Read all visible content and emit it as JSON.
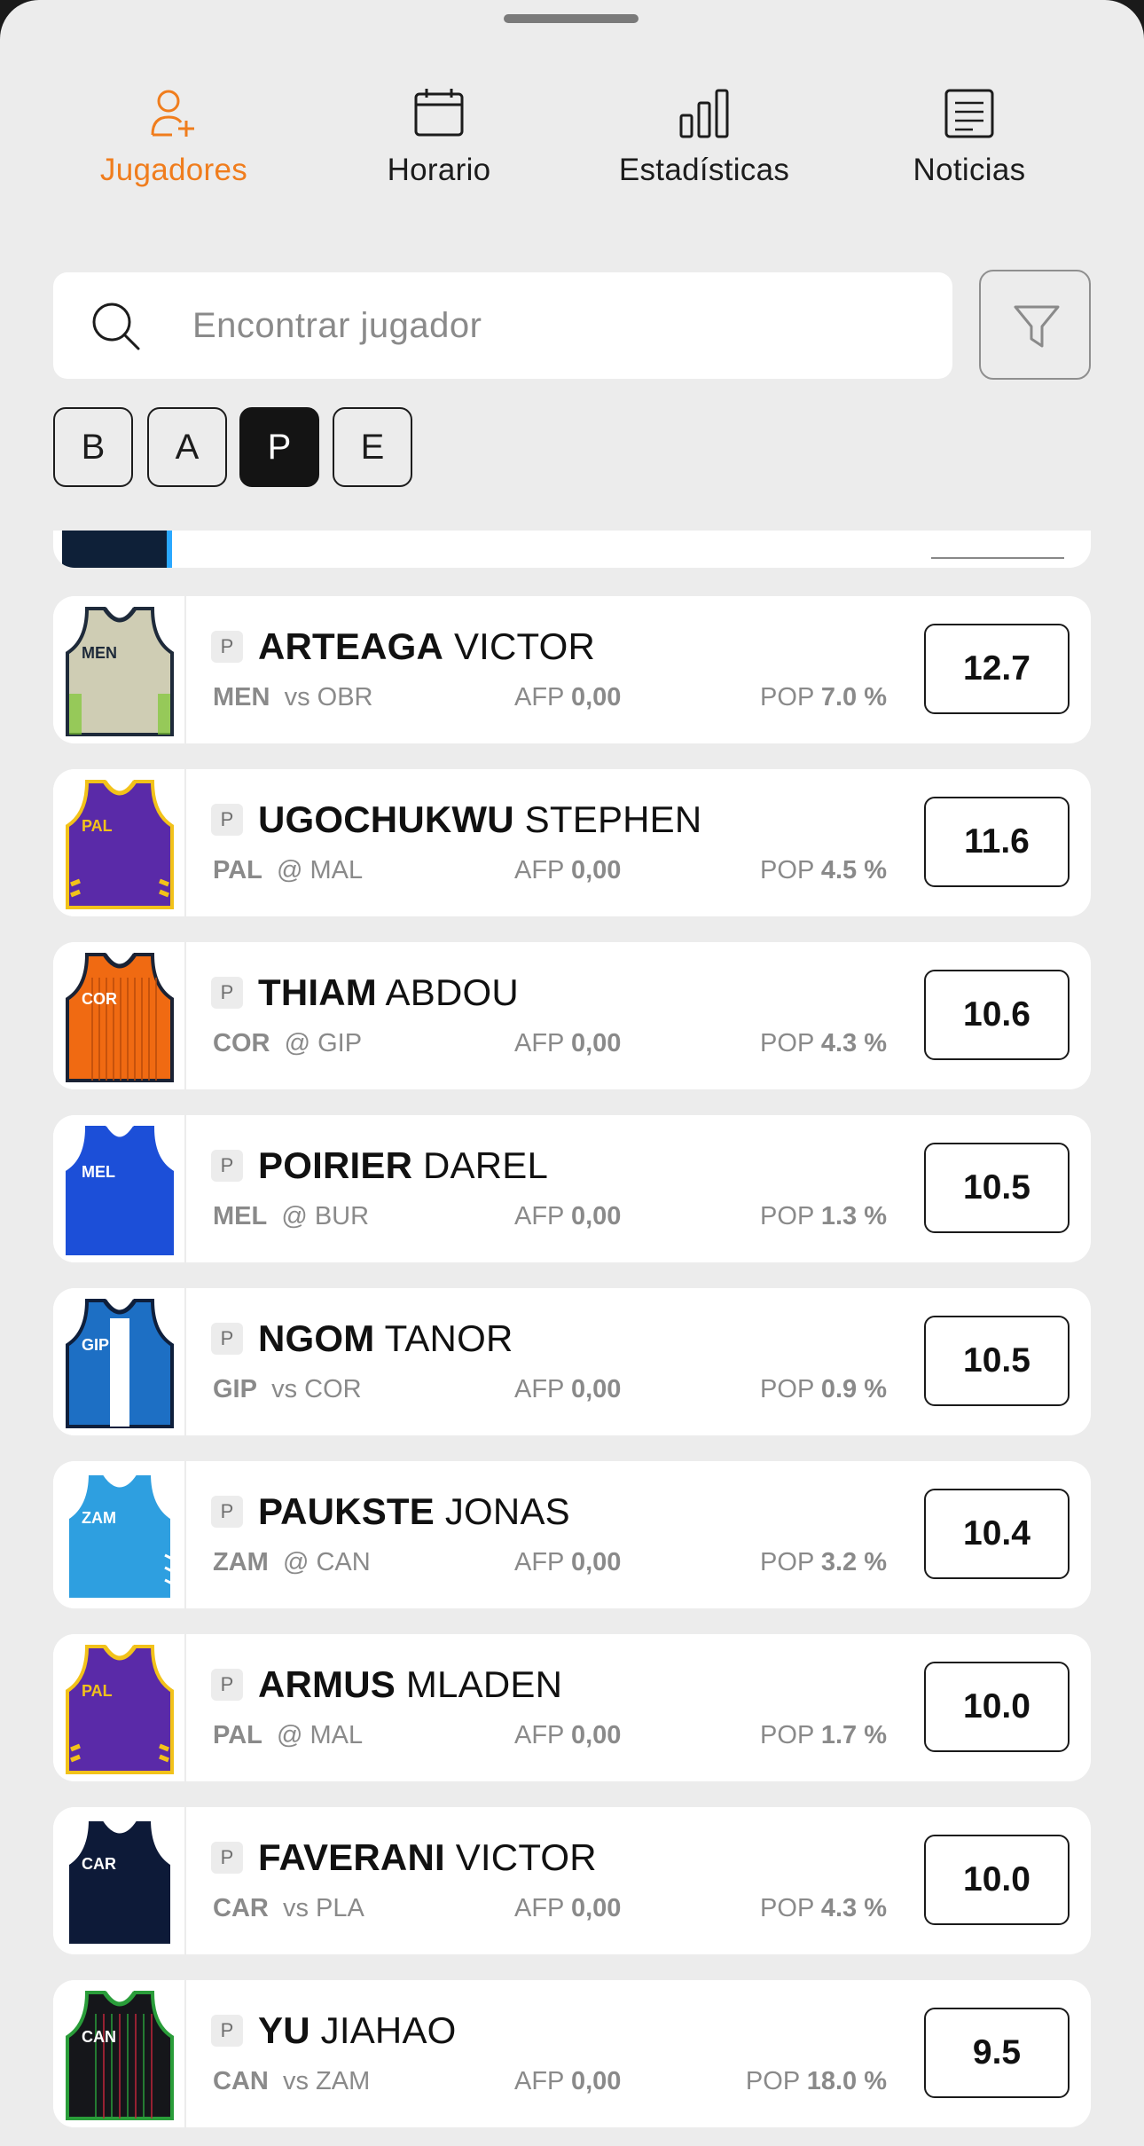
{
  "tabs": [
    {
      "label": "Jugadores",
      "icon": "add-user-icon",
      "active": true
    },
    {
      "label": "Horario",
      "icon": "calendar-icon",
      "active": false
    },
    {
      "label": "Estadísticas",
      "icon": "bar-chart-icon",
      "active": false
    },
    {
      "label": "Noticias",
      "icon": "news-icon",
      "active": false
    }
  ],
  "search": {
    "placeholder": "Encontrar jugador",
    "icon": "search-icon"
  },
  "filter": {
    "icon": "filter-icon"
  },
  "positions": [
    {
      "label": "B",
      "active": false
    },
    {
      "label": "A",
      "active": false
    },
    {
      "label": "P",
      "active": true
    },
    {
      "label": "E",
      "active": false
    }
  ],
  "colors": {
    "accent": "#f07d1d",
    "background": "#ececec",
    "card": "#ffffff",
    "active_chip": "#141414"
  },
  "players": [
    {
      "pos": "P",
      "last": "ARTEAGA",
      "first": "VICTOR",
      "team": "MEN",
      "matchup": "vs OBR",
      "afp_label": "AFP",
      "afp": "0,00",
      "pop_label": "POP",
      "pop": "7.0 %",
      "price": "12.7",
      "jersey": "men"
    },
    {
      "pos": "P",
      "last": "UGOCHUKWU",
      "first": "STEPHEN",
      "team": "PAL",
      "matchup": "@ MAL",
      "afp_label": "AFP",
      "afp": "0,00",
      "pop_label": "POP",
      "pop": "4.5 %",
      "price": "11.6",
      "jersey": "pal"
    },
    {
      "pos": "P",
      "last": "THIAM",
      "first": "ABDOU",
      "team": "COR",
      "matchup": "@ GIP",
      "afp_label": "AFP",
      "afp": "0,00",
      "pop_label": "POP",
      "pop": "4.3 %",
      "price": "10.6",
      "jersey": "cor"
    },
    {
      "pos": "P",
      "last": "POIRIER",
      "first": "DAREL",
      "team": "MEL",
      "matchup": "@ BUR",
      "afp_label": "AFP",
      "afp": "0,00",
      "pop_label": "POP",
      "pop": "1.3 %",
      "price": "10.5",
      "jersey": "mel"
    },
    {
      "pos": "P",
      "last": "NGOM",
      "first": "TANOR",
      "team": "GIP",
      "matchup": "vs COR",
      "afp_label": "AFP",
      "afp": "0,00",
      "pop_label": "POP",
      "pop": "0.9 %",
      "price": "10.5",
      "jersey": "gip"
    },
    {
      "pos": "P",
      "last": "PAUKSTE",
      "first": "JONAS",
      "team": "ZAM",
      "matchup": "@ CAN",
      "afp_label": "AFP",
      "afp": "0,00",
      "pop_label": "POP",
      "pop": "3.2 %",
      "price": "10.4",
      "jersey": "zam"
    },
    {
      "pos": "P",
      "last": "ARMUS",
      "first": "MLADEN",
      "team": "PAL",
      "matchup": "@ MAL",
      "afp_label": "AFP",
      "afp": "0,00",
      "pop_label": "POP",
      "pop": "1.7 %",
      "price": "10.0",
      "jersey": "pal"
    },
    {
      "pos": "P",
      "last": "FAVERANI",
      "first": "VICTOR",
      "team": "CAR",
      "matchup": "vs PLA",
      "afp_label": "AFP",
      "afp": "0,00",
      "pop_label": "POP",
      "pop": "4.3 %",
      "price": "10.0",
      "jersey": "car"
    },
    {
      "pos": "P",
      "last": "YU",
      "first": "JIAHAO",
      "team": "CAN",
      "matchup": "vs ZAM",
      "afp_label": "AFP",
      "afp": "0,00",
      "pop_label": "POP",
      "pop": "18.0 %",
      "price": "9.5",
      "jersey": "can"
    }
  ]
}
